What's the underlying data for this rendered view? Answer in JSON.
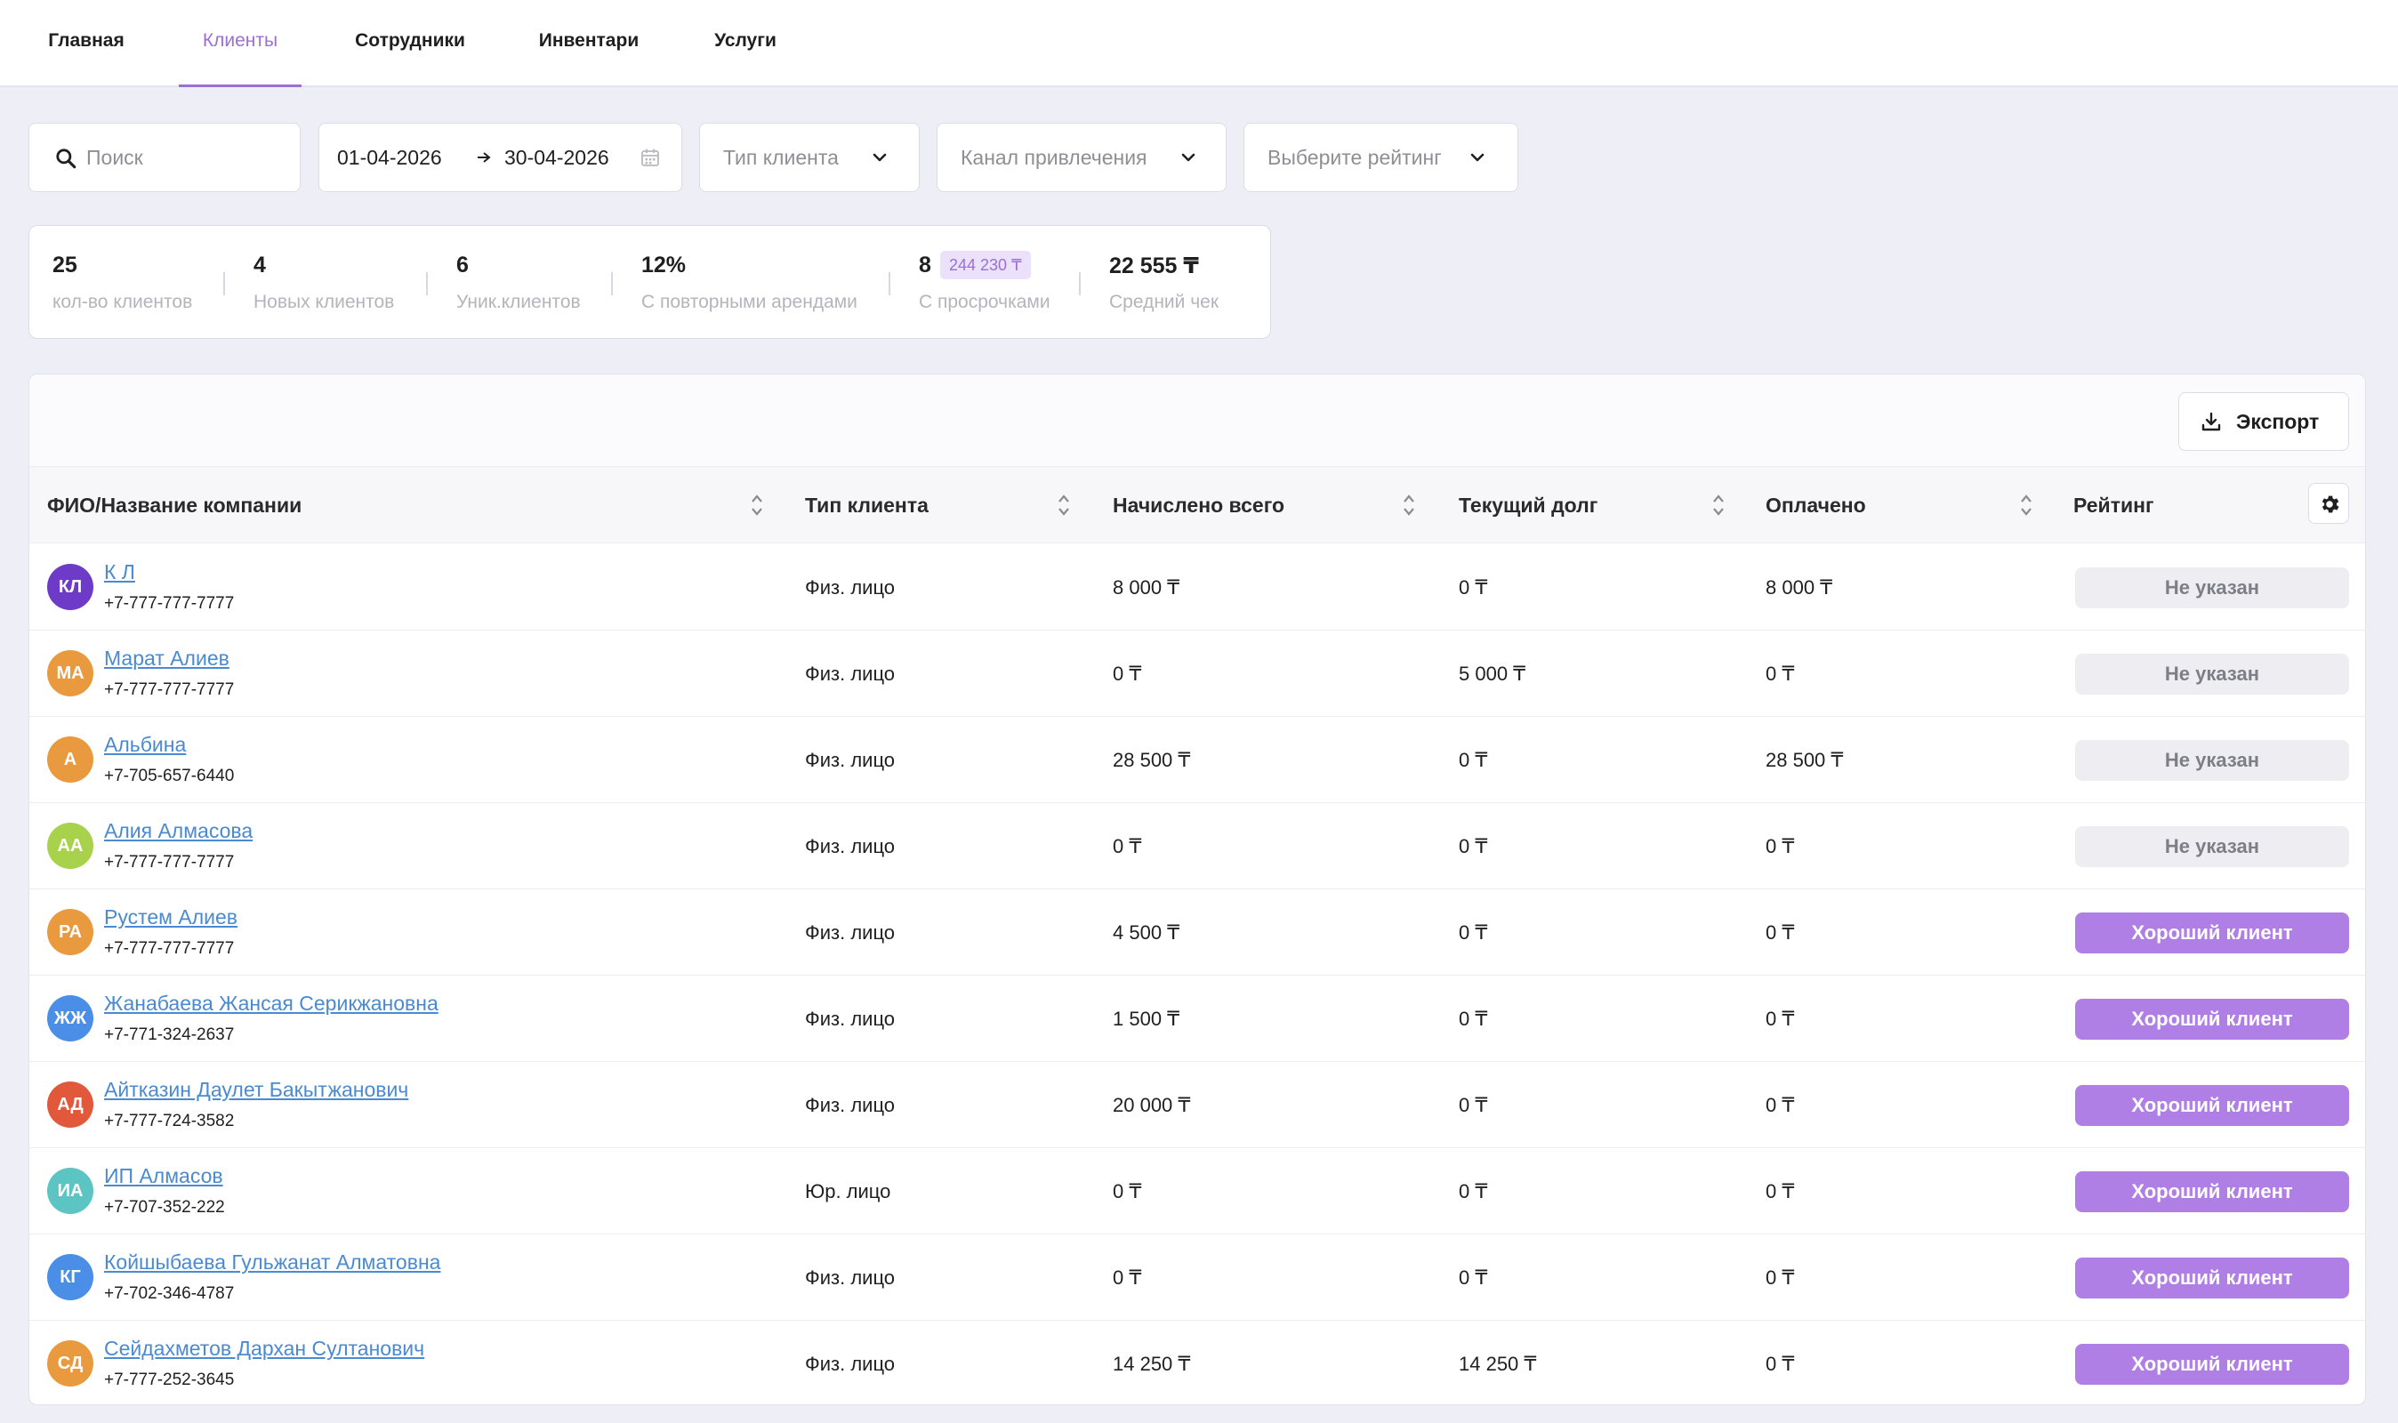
{
  "nav": {
    "tabs": [
      {
        "label": "Главная"
      },
      {
        "label": "Клиенты"
      },
      {
        "label": "Сотрудники"
      },
      {
        "label": "Инвентари"
      },
      {
        "label": "Услуги"
      }
    ],
    "active_tab": "Клиенты"
  },
  "filters": {
    "search_placeholder": "Поиск",
    "date_from": "01-04-2026",
    "date_to": "30-04-2026",
    "client_type_placeholder": "Тип клиента",
    "channel_placeholder": "Канал привлечения",
    "rating_placeholder": "Выберите рейтинг"
  },
  "stats": [
    {
      "value": "25",
      "label": "кол-во клиентов"
    },
    {
      "value": "4",
      "label": "Новых клиентов"
    },
    {
      "value": "6",
      "label": "Уник.клиентов"
    },
    {
      "value": "12%",
      "label": "С повторными арендами"
    },
    {
      "value": "8",
      "label": "С просрочками",
      "chip": "244 230 ₸"
    },
    {
      "value": "22 555 ₸",
      "label": "Средний чек"
    }
  ],
  "toolbar": {
    "export_label": "Экспорт"
  },
  "table": {
    "columns": [
      "ФИО/Название компании",
      "Тип клиента",
      "Начислено всего",
      "Текущий долг",
      "Оплачено",
      "Рейтинг"
    ],
    "rows": [
      {
        "initials": "КЛ",
        "avatar_color": "#6e3bc8",
        "name": "К Л",
        "phone": "+7-777-777-7777",
        "type": "Физ. лицо",
        "charged": "8 000 ₸",
        "debt": "0 ₸",
        "paid": "8 000 ₸",
        "rating": "Не указан",
        "rating_kind": "none"
      },
      {
        "initials": "МА",
        "avatar_color": "#e99a3f",
        "name": "Марат Алиев",
        "phone": "+7-777-777-7777",
        "type": "Физ. лицо",
        "charged": "0 ₸",
        "debt": "5 000 ₸",
        "paid": "0 ₸",
        "rating": "Не указан",
        "rating_kind": "none"
      },
      {
        "initials": "А",
        "avatar_color": "#e99a3f",
        "name": "Альбина",
        "phone": "+7-705-657-6440",
        "type": "Физ. лицо",
        "charged": "28 500 ₸",
        "debt": "0 ₸",
        "paid": "28 500 ₸",
        "rating": "Не указан",
        "rating_kind": "none"
      },
      {
        "initials": "АА",
        "avatar_color": "#a8d24b",
        "name": "Алия Алмасова",
        "phone": "+7-777-777-7777",
        "type": "Физ. лицо",
        "charged": "0 ₸",
        "debt": "0 ₸",
        "paid": "0 ₸",
        "rating": "Не указан",
        "rating_kind": "none"
      },
      {
        "initials": "РА",
        "avatar_color": "#e99a3f",
        "name": "Рустем Алиев",
        "phone": "+7-777-777-7777",
        "type": "Физ. лицо",
        "charged": "4 500 ₸",
        "debt": "0 ₸",
        "paid": "0 ₸",
        "rating": "Хороший клиент",
        "rating_kind": "good"
      },
      {
        "initials": "ЖЖ",
        "avatar_color": "#4a8ee8",
        "name": "Жанабаева Жансая Серикжановна",
        "phone": "+7-771-324-2637",
        "type": "Физ. лицо",
        "charged": "1 500 ₸",
        "debt": "0 ₸",
        "paid": "0 ₸",
        "rating": "Хороший клиент",
        "rating_kind": "good"
      },
      {
        "initials": "АД",
        "avatar_color": "#e2583a",
        "name": "Айтказин Даулет Бакытжанович",
        "phone": "+7-777-724-3582",
        "type": "Физ. лицо",
        "charged": "20 000 ₸",
        "debt": "0 ₸",
        "paid": "0 ₸",
        "rating": "Хороший клиент",
        "rating_kind": "good"
      },
      {
        "initials": "ИА",
        "avatar_color": "#5cc4c2",
        "name": "ИП Алмасов",
        "phone": "+7-707-352-222",
        "type": "Юр. лицо",
        "charged": "0 ₸",
        "debt": "0 ₸",
        "paid": "0 ₸",
        "rating": "Хороший клиент",
        "rating_kind": "good"
      },
      {
        "initials": "КГ",
        "avatar_color": "#4a8ee8",
        "name": "Койшыбаева Гульжанат Алматовна",
        "phone": "+7-702-346-4787",
        "type": "Физ. лицо",
        "charged": "0 ₸",
        "debt": "0 ₸",
        "paid": "0 ₸",
        "rating": "Хороший клиент",
        "rating_kind": "good"
      },
      {
        "initials": "СД",
        "avatar_color": "#e99a3f",
        "name": "Сейдахметов Дархан Султанович",
        "phone": "+7-777-252-3645",
        "type": "Физ. лицо",
        "charged": "14 250 ₸",
        "debt": "14 250 ₸",
        "paid": "0 ₸",
        "rating": "Хороший клиент",
        "rating_kind": "good"
      }
    ]
  },
  "colors": {
    "accent": "#9a6fd6",
    "badge_good": "#b07fe6",
    "link": "#4a8ad0"
  }
}
